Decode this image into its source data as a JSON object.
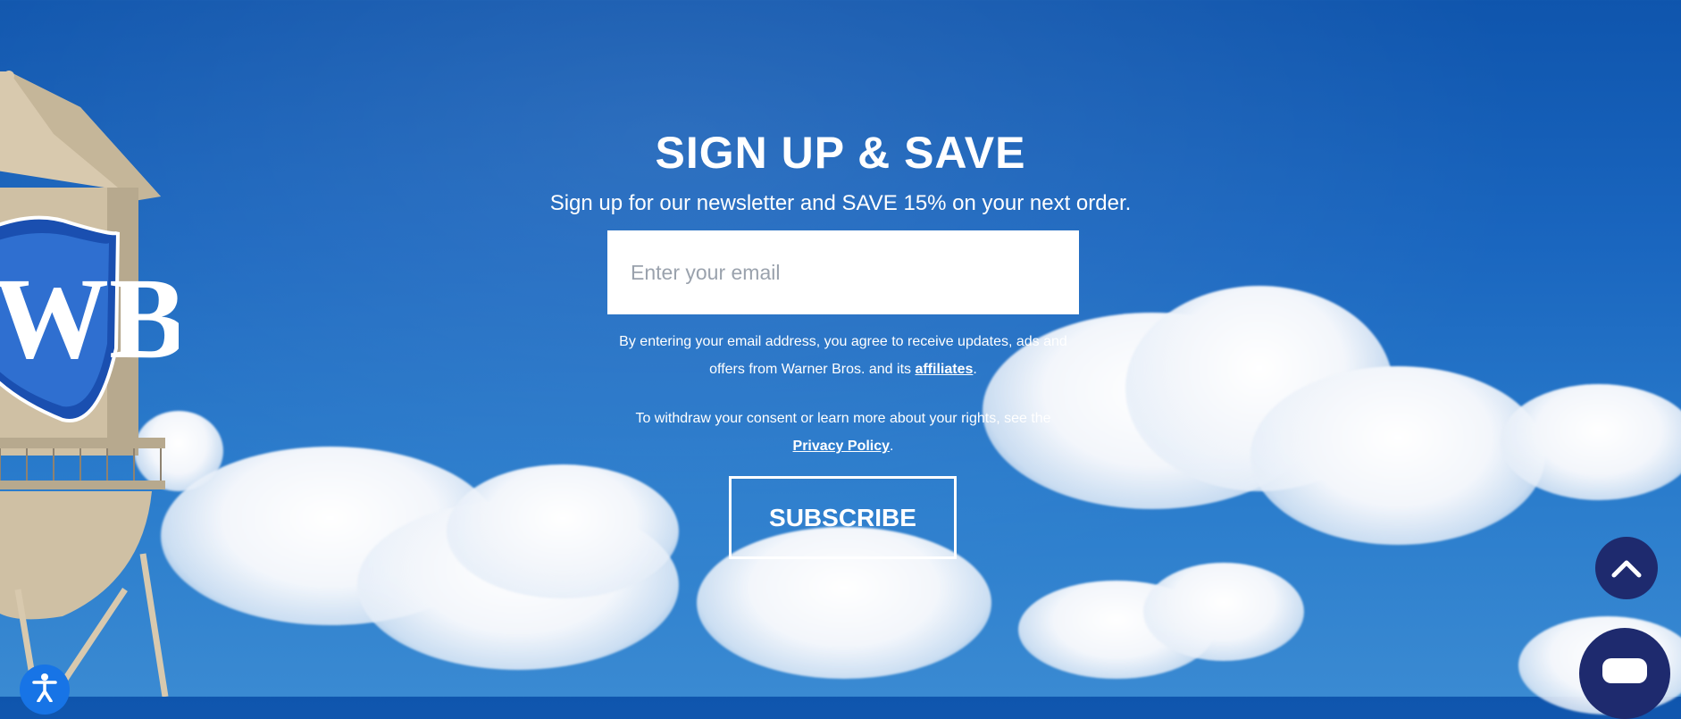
{
  "newsletter": {
    "title": "SIGN UP & SAVE",
    "subtitle": "Sign up for our newsletter and SAVE 15% on your next order.",
    "email_placeholder": "Enter your email",
    "consent_text_1": "By entering your email address, you agree to receive updates, ads and offers from Warner Bros. and its ",
    "affiliates_link": "affiliates",
    "consent_text_1_end": ".",
    "consent_text_2": "To withdraw your consent or learn more about your rights, see the ",
    "privacy_link": "Privacy Policy",
    "consent_text_2_end": ".",
    "subscribe_label": "SUBSCRIBE"
  },
  "floating": {
    "scroll_top_icon": "chevron-up-icon",
    "chat_icon": "chat-bubble-icon",
    "accessibility_icon": "accessibility-icon"
  },
  "colors": {
    "sky": "#1a66bf",
    "button_navy": "#1e2a6e",
    "accessibility_blue": "#1774e6",
    "wb_blue": "#1a4fb0"
  }
}
